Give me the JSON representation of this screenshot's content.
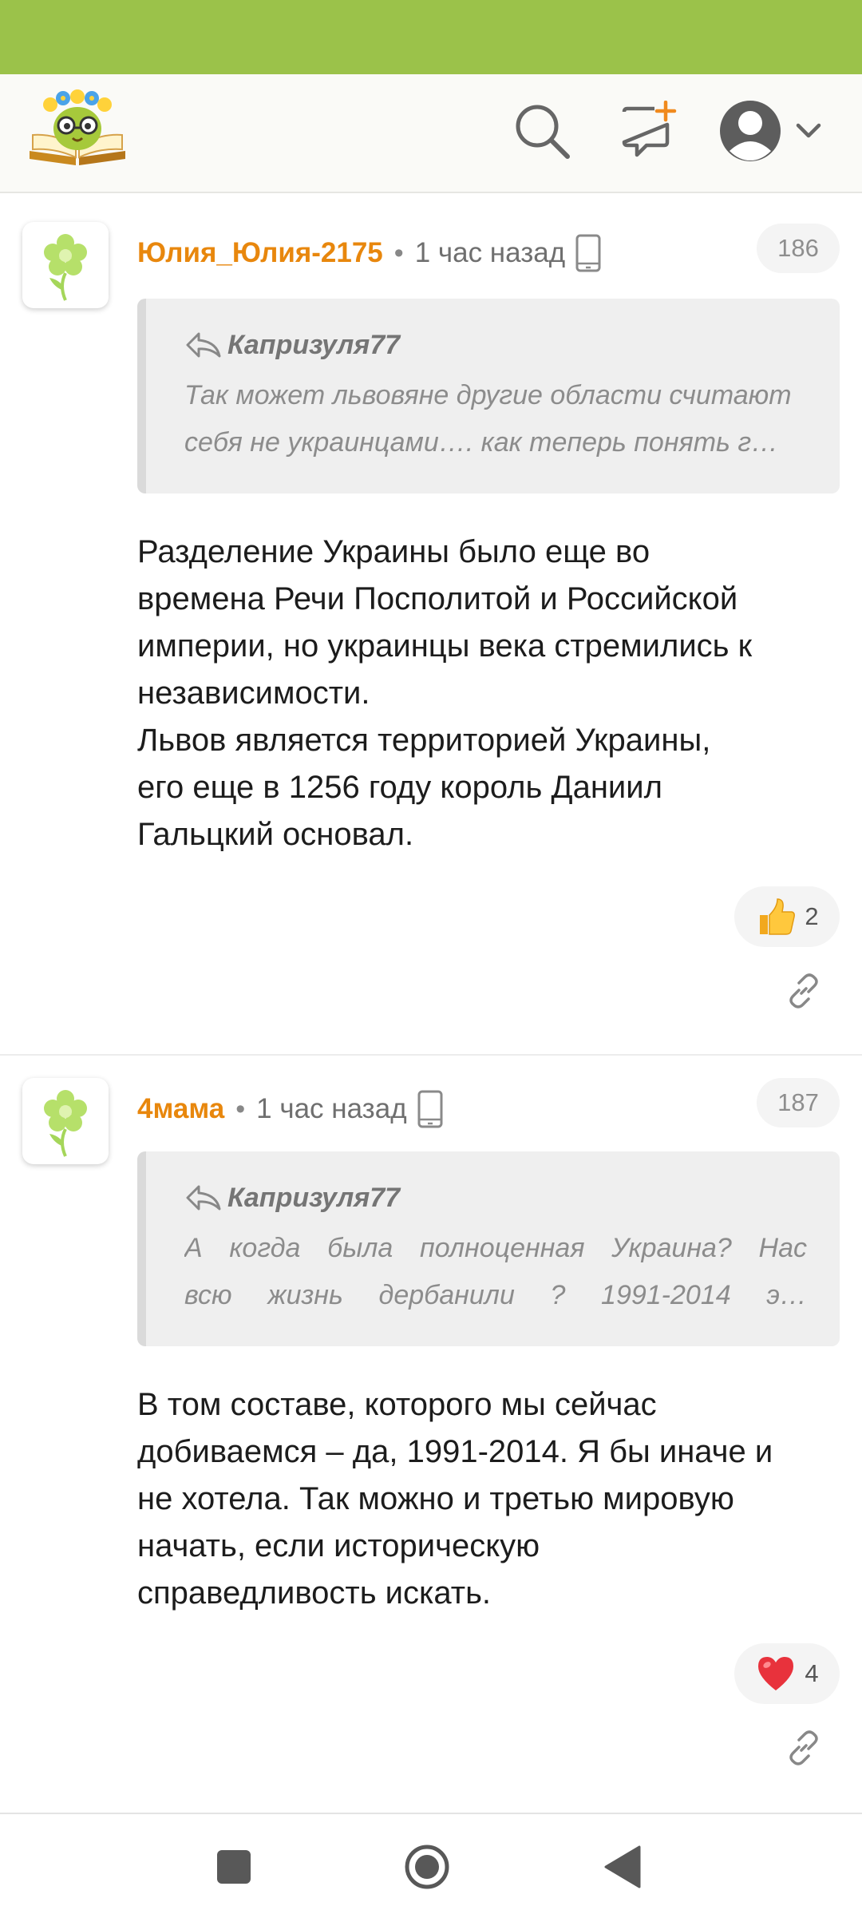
{
  "header": {
    "logo_icon": "book-owl-logo",
    "search_icon": "search-icon",
    "new_post_icon": "chat-plus-icon",
    "account_icon": "user-avatar-icon",
    "menu_icon": "chevron-down-icon"
  },
  "comments": [
    {
      "author": "Юлия_Юлия-2175",
      "separator": "•",
      "time": "1 час назад",
      "device_icon": "mobile-phone-icon",
      "number": "186",
      "quote_author": "Капризуля77",
      "quote_lines": [
        "Так может львовяне другие области считают",
        "себя не украинцами…. как теперь понять г…"
      ],
      "body_lines": [
        "Разделение Украины было еще во",
        "времена Речи Посполитой и Российской",
        "империи, но украинцы века стремились к",
        "независимости.",
        "Львов является территорией Украины,",
        "его еще в 1256 году король Даниил",
        "Гальцкий основал."
      ],
      "reaction_icon": "thumbs-up-icon",
      "reaction_count": "2",
      "link_icon": "link-icon"
    },
    {
      "author": "4мама",
      "separator": "•",
      "time": "1 час назад",
      "device_icon": "mobile-phone-icon",
      "number": "187",
      "quote_author": "Капризуля77",
      "quote_lines": [
        "А когда была полноценная Украина? Нас",
        "всю жизнь дербанили ? 1991-2014 э…"
      ],
      "body_lines": [
        "В том составе, которого мы сейчас",
        "добиваемся – да, 1991-2014. Я бы иначе и",
        "не хотела. Так можно и третью мировую",
        "начать, если историческую",
        "справедливость искать."
      ],
      "reaction_icon": "heart-icon",
      "reaction_count": "4",
      "link_icon": "link-icon"
    }
  ],
  "colors": {
    "status_bar": "#9bc24a",
    "author": "#e8870d",
    "quote_bg": "#efefef"
  }
}
